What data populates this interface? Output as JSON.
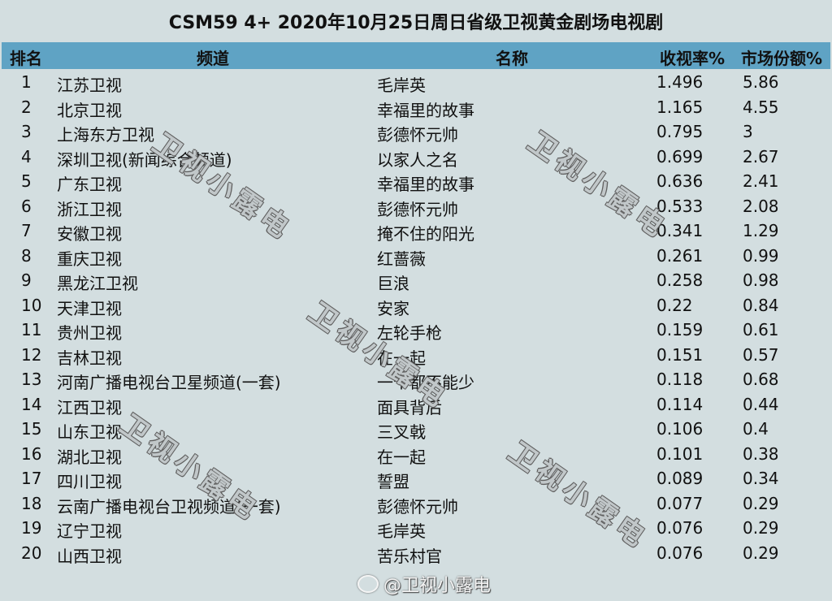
{
  "title": "CSM59 4+ 2020年10月25日周日省级卫视黄金剧场电视剧",
  "header": {
    "rank": "排名",
    "channel": "频道",
    "name": "名称",
    "rating": "收视率%",
    "share": "市场份额%"
  },
  "rows": [
    {
      "rank": "1",
      "channel": "江苏卫视",
      "name": "毛岸英",
      "rating": "1.496",
      "share": "5.86"
    },
    {
      "rank": "2",
      "channel": "北京卫视",
      "name": "幸福里的故事",
      "rating": "1.165",
      "share": "4.55"
    },
    {
      "rank": "3",
      "channel": "上海东方卫视",
      "name": "彭德怀元帅",
      "rating": "0.795",
      "share": "3"
    },
    {
      "rank": "4",
      "channel": "深圳卫视(新闻综合频道)",
      "name": "以家人之名",
      "rating": "0.699",
      "share": "2.67"
    },
    {
      "rank": "5",
      "channel": "广东卫视",
      "name": "幸福里的故事",
      "rating": "0.636",
      "share": "2.41"
    },
    {
      "rank": "6",
      "channel": "浙江卫视",
      "name": "彭德怀元帅",
      "rating": "0.533",
      "share": "2.08"
    },
    {
      "rank": "7",
      "channel": "安徽卫视",
      "name": "掩不住的阳光",
      "rating": "0.341",
      "share": "1.29"
    },
    {
      "rank": "8",
      "channel": "重庆卫视",
      "name": "红蔷薇",
      "rating": "0.261",
      "share": "0.99"
    },
    {
      "rank": "9",
      "channel": "黑龙江卫视",
      "name": "巨浪",
      "rating": "0.258",
      "share": "0.98"
    },
    {
      "rank": "10",
      "channel": "天津卫视",
      "name": "安家",
      "rating": "0.22",
      "share": "0.84"
    },
    {
      "rank": "11",
      "channel": "贵州卫视",
      "name": "左轮手枪",
      "rating": "0.159",
      "share": "0.61"
    },
    {
      "rank": "12",
      "channel": "吉林卫视",
      "name": "在一起",
      "rating": "0.151",
      "share": "0.57"
    },
    {
      "rank": "13",
      "channel": "河南广播电视台卫星频道(一套)",
      "name": "一个都不能少",
      "rating": "0.118",
      "share": "0.68"
    },
    {
      "rank": "14",
      "channel": "江西卫视",
      "name": "面具背后",
      "rating": "0.114",
      "share": "0.44"
    },
    {
      "rank": "15",
      "channel": "山东卫视",
      "name": "三叉戟",
      "rating": "0.106",
      "share": "0.4"
    },
    {
      "rank": "16",
      "channel": "湖北卫视",
      "name": "在一起",
      "rating": "0.101",
      "share": "0.38"
    },
    {
      "rank": "17",
      "channel": "四川卫视",
      "name": "誓盟",
      "rating": "0.089",
      "share": "0.34"
    },
    {
      "rank": "18",
      "channel": "云南广播电视台卫视频道(一套)",
      "name": "彭德怀元帅",
      "rating": "0.077",
      "share": "0.29"
    },
    {
      "rank": "19",
      "channel": "辽宁卫视",
      "name": "毛岸英",
      "rating": "0.076",
      "share": "0.29"
    },
    {
      "rank": "20",
      "channel": "山西卫视",
      "name": "苦乐村官",
      "rating": "0.076",
      "share": "0.29"
    }
  ],
  "watermark": {
    "text": "卫视小露电",
    "weibo": "@卫视小露电",
    "icon": "weibo-icon"
  }
}
